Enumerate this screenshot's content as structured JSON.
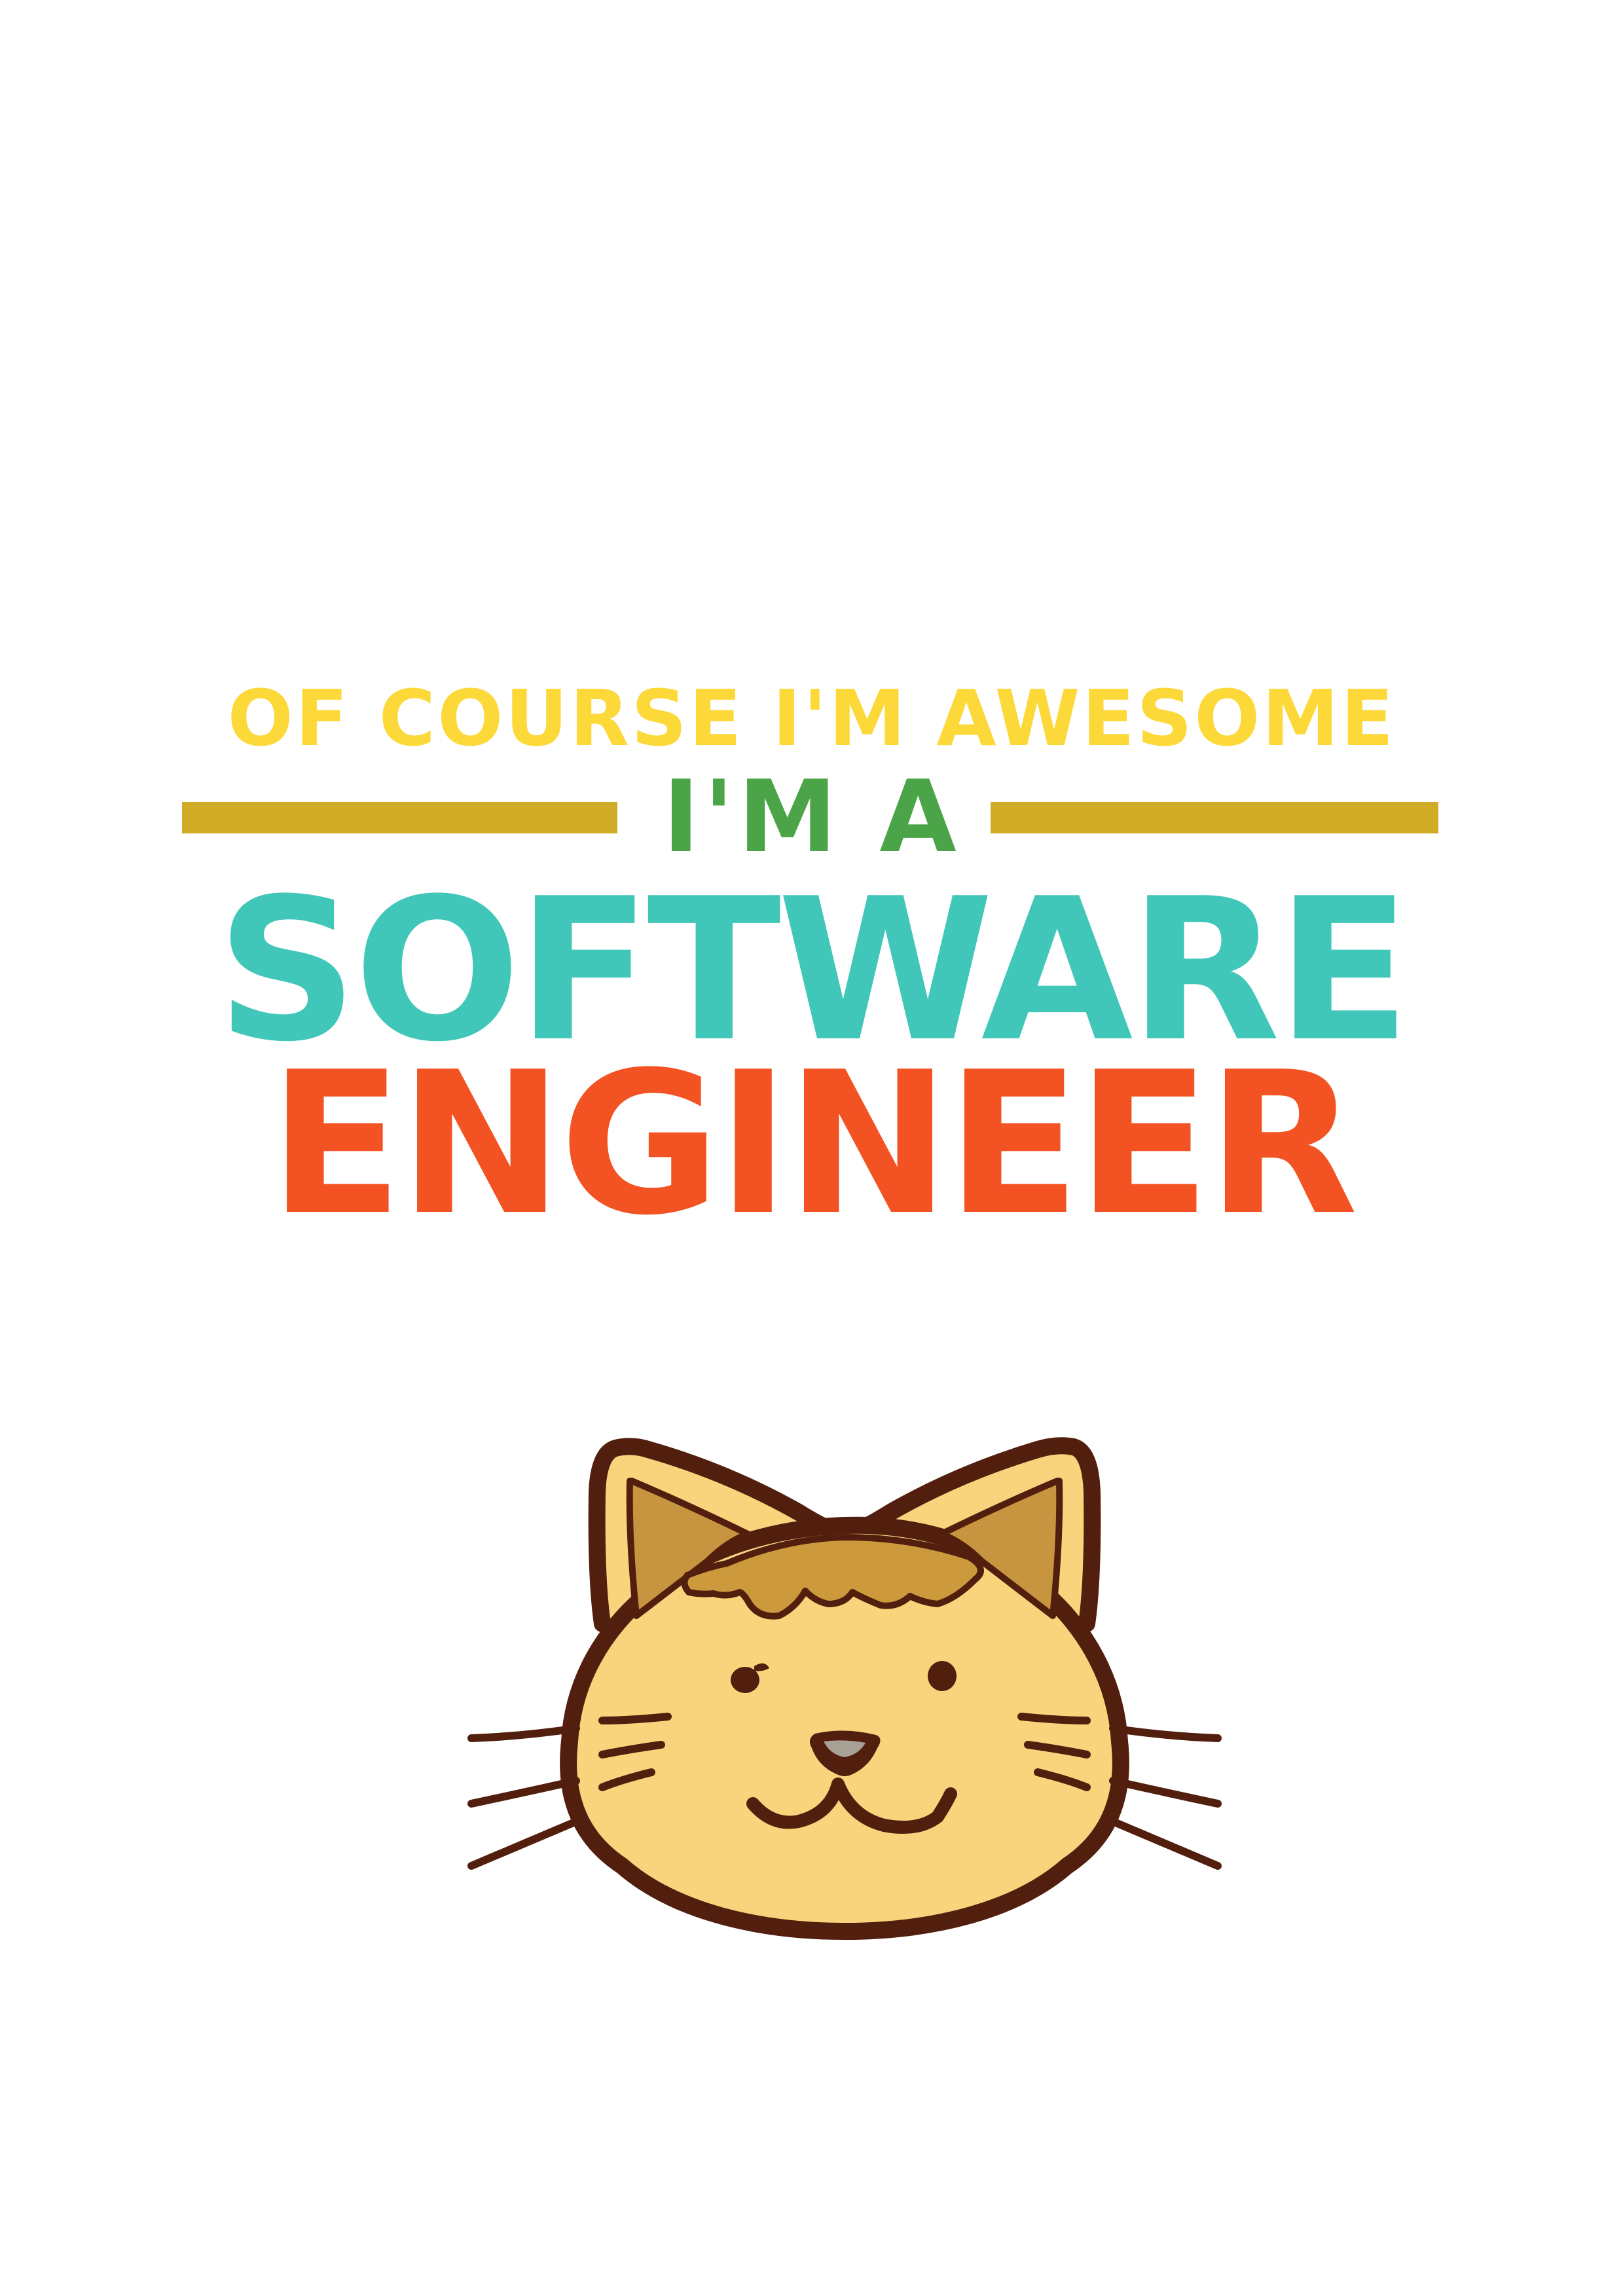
{
  "poster": {
    "line1": "OF COURSE I'M AWESOME",
    "line2": "I'M A",
    "line3": "SOFTWARE",
    "line4": "ENGINEER",
    "illustration": "cat-face-icon"
  },
  "colors": {
    "background": "#ffffff",
    "line1": "#fcd839",
    "line2": "#4ba548",
    "line3": "#40c7b9",
    "line4": "#f35322",
    "rule": "#d0ab26",
    "cat_outline": "#521e0e",
    "cat_face": "#fad47c",
    "cat_tuft": "#cc9a3c",
    "cat_ear_inner": "#c7953f",
    "cat_tongue": "#a8a296"
  }
}
